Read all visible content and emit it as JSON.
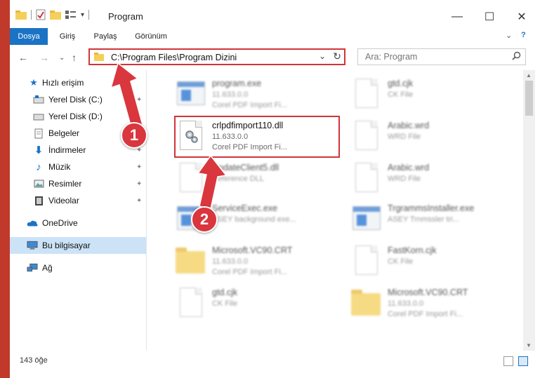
{
  "window": {
    "title": "Program",
    "controls": {
      "minimize": "—",
      "maximize": "☐",
      "close": "✕"
    }
  },
  "ribbon": {
    "tabs": [
      "Dosya",
      "Giriş",
      "Paylaş",
      "Görünüm"
    ],
    "active_tab": "Dosya",
    "collapse_glyph": "⌄",
    "help_glyph": "?"
  },
  "address": {
    "path": "C:\\Program Files\\Program Dizini",
    "dropdown_glyph": "⌄",
    "refresh_glyph": "↻"
  },
  "search": {
    "placeholder": "Ara: Program",
    "icon": "search-icon"
  },
  "nav": {
    "back": "←",
    "forward": "→",
    "recent": "⌄",
    "up": "↑",
    "items": [
      {
        "label": "Hızlı erişim",
        "icon": "star-icon",
        "pinned": false
      },
      {
        "label": "Yerel Disk (C:)",
        "icon": "drive-icon",
        "pinned": true
      },
      {
        "label": "Yerel Disk (D:)",
        "icon": "drive-icon",
        "pinned": true
      },
      {
        "label": "Belgeler",
        "icon": "document-icon",
        "pinned": true
      },
      {
        "label": "İndirmeler",
        "icon": "download-icon",
        "pinned": true
      },
      {
        "label": "Müzik",
        "icon": "music-icon",
        "pinned": true
      },
      {
        "label": "Resimler",
        "icon": "pictures-icon",
        "pinned": true
      },
      {
        "label": "Videolar",
        "icon": "video-icon",
        "pinned": true
      },
      {
        "label": "OneDrive",
        "icon": "cloud-icon",
        "pinned": false
      },
      {
        "label": "Bu bilgisayar",
        "icon": "computer-icon",
        "pinned": false,
        "selected": true
      },
      {
        "label": "Ağ",
        "icon": "network-icon",
        "pinned": false
      }
    ],
    "pin_glyph": "📌"
  },
  "files": {
    "highlighted": {
      "name": "crlpdfimport110.dll",
      "version": "11.633.0.0",
      "description": "Corel PDF Import Fi..."
    },
    "left_column": [
      {
        "name": "program.exe",
        "version": "11.633.0.0",
        "description": "Corel PDF Import Fi...",
        "kind": "exe"
      },
      {
        "name": "...",
        "version": "",
        "description": "",
        "kind": "placeholder"
      },
      {
        "name": "UpdateClient5.dll",
        "version": "Reference DLL",
        "description": "",
        "kind": "dll"
      },
      {
        "name": "ServiceExec.exe",
        "version": "ASEY background exe...",
        "description": "",
        "kind": "app"
      },
      {
        "name": "Microsoft.VC90.CRT",
        "version": "11.633.0.0",
        "description": "Corel PDF Import Fi...",
        "kind": "folder"
      },
      {
        "name": "gtd.cjk",
        "version": "CK File",
        "description": "",
        "kind": "doc"
      }
    ],
    "right_column": [
      {
        "name": "gtd.cjk",
        "version": "CK File",
        "description": "",
        "kind": "doc"
      },
      {
        "name": "Arabic.wrd",
        "version": "WRD File",
        "description": "",
        "kind": "doc"
      },
      {
        "name": "Arabic.wrd",
        "version": "WRD File",
        "description": "",
        "kind": "doc"
      },
      {
        "name": "TrgrammsInstaller.exe",
        "version": "ASEY Trnmssler tri...",
        "description": "",
        "kind": "app"
      },
      {
        "name": "FastKorn.cjk",
        "version": "CK File",
        "description": "",
        "kind": "doc"
      },
      {
        "name": "Microsoft.VC90.CRT",
        "version": "11.633.0.0",
        "description": "Corel PDF Import Fi...",
        "kind": "folder"
      }
    ]
  },
  "status": {
    "count": "143 öğe"
  },
  "callouts": {
    "one": "1",
    "two": "2"
  },
  "colors": {
    "accent": "#1a73c5",
    "highlight_border": "#d13438",
    "callout": "#d9363e",
    "selected_nav": "#cce3f7"
  }
}
